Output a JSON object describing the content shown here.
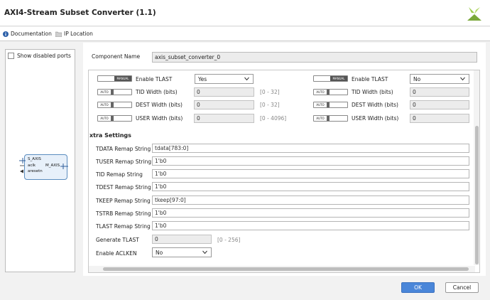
{
  "window": {
    "title": "AXI4-Stream Subset Converter (1.1)"
  },
  "links": {
    "documentation": "Documentation",
    "ip_location": "IP Location"
  },
  "left_panel": {
    "show_disabled_ports": "Show disabled ports",
    "ip_symbol": {
      "port_s_axis": "S_AXIS",
      "port_aclk": "aclk",
      "port_aresetn": "aresetn",
      "port_m_axis": "M_AXIS"
    }
  },
  "component": {
    "label": "Component Name",
    "value": "axis_subset_converter_0"
  },
  "si_settings": [
    {
      "mode": "MANUAL",
      "label": "Enable TLAST",
      "value": "Yes",
      "range": "",
      "kind": "select"
    },
    {
      "mode": "AUTO",
      "label": "TID Width (bits)",
      "value": "0",
      "range": "[0 - 32]",
      "kind": "field"
    },
    {
      "mode": "AUTO",
      "label": "DEST Width (bits)",
      "value": "0",
      "range": "[0 - 32]",
      "kind": "field"
    },
    {
      "mode": "AUTO",
      "label": "USER Width (bits)",
      "value": "0",
      "range": "[0 - 4096]",
      "kind": "field"
    }
  ],
  "mi_settings": [
    {
      "mode": "MANUAL",
      "label": "Enable TLAST",
      "value": "No",
      "kind": "select"
    },
    {
      "mode": "AUTO",
      "label": "TID Width (bits)",
      "value": "0",
      "kind": "field"
    },
    {
      "mode": "AUTO",
      "label": "DEST Width (bits)",
      "value": "0",
      "kind": "field"
    },
    {
      "mode": "AUTO",
      "label": "USER Width (bits)",
      "value": "0",
      "kind": "field"
    }
  ],
  "extra": {
    "heading": "xtra Settings",
    "remaps": [
      {
        "label": "TDATA Remap String",
        "value": "tdata[783:0]"
      },
      {
        "label": "TUSER Remap String",
        "value": "1'b0"
      },
      {
        "label": "TID Remap String",
        "value": "1'b0"
      },
      {
        "label": "TDEST Remap String",
        "value": "1'b0"
      },
      {
        "label": "TKEEP Remap String",
        "value": "tkeep[97:0]"
      },
      {
        "label": "TSTRB Remap String",
        "value": "1'b0"
      },
      {
        "label": "TLAST Remap String",
        "value": "1'b0"
      }
    ],
    "generate_tlast": {
      "label": "Generate TLAST",
      "value": "0",
      "range": "[0 - 256]"
    },
    "enable_aclken": {
      "label": "Enable ACLKEN",
      "value": "No"
    }
  },
  "buttons": {
    "ok": "OK",
    "cancel": "Cancel"
  },
  "colors": {
    "accent": "#4a86d9",
    "logo": "#8dbf3f"
  }
}
